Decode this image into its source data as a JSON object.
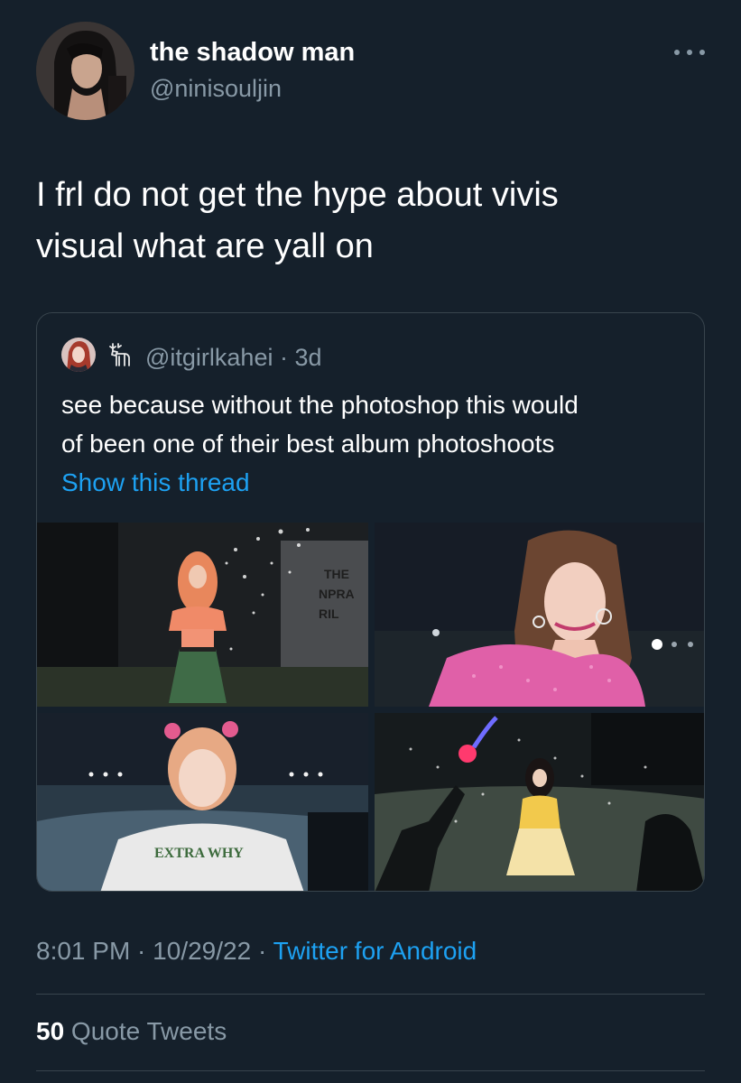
{
  "author": {
    "display_name": "the shadow man",
    "handle": "@ninisouljin",
    "avatar_icon": "profile-photo"
  },
  "tweet": {
    "text_line1": "I frl do not get the hype about vivis",
    "text_line2": "visual what are yall on"
  },
  "quoted_tweet": {
    "handle_line": "@itgirlkahei · 3d",
    "text_line1": "see because without the photoshop this would",
    "text_line2": "of been one of their best album photoshoots",
    "show_thread_label": "Show this thread",
    "photos": [
      {
        "name": "photo-orange-hair-green-skirt"
      },
      {
        "name": "photo-pink-sequin-top"
      },
      {
        "name": "photo-white-extra-shirt"
      },
      {
        "name": "photo-yellow-dress-night"
      }
    ],
    "photo_shirt_text": "EXTRA WHY",
    "photo_bg_text": "THE\nNPRA\nRIL"
  },
  "meta": {
    "time": "8:01 PM",
    "separator": " · ",
    "date": "10/29/22",
    "source": "Twitter for Android"
  },
  "stats": {
    "quote_count": "50",
    "quote_label": " Quote Tweets"
  },
  "colors": {
    "background": "#15202b",
    "secondary_text": "#8899a6",
    "link": "#1da1f2",
    "border": "#38444d"
  }
}
